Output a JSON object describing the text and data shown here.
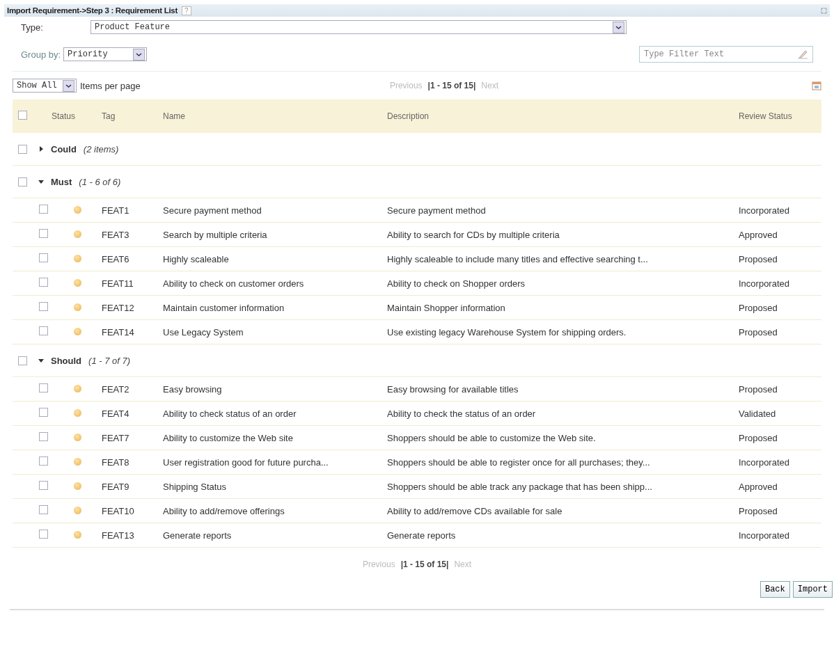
{
  "window": {
    "title": "Import Requirement->Step 3 : Requirement List",
    "help": "?"
  },
  "type_field": {
    "label": "Type:",
    "value": "Product Feature"
  },
  "group_by": {
    "label": "Group by:",
    "value": "Priority"
  },
  "filter": {
    "placeholder": "Type Filter Text"
  },
  "paging": {
    "page_size": "Show All",
    "page_size_label": "Items per page",
    "previous": "Previous",
    "range": "|1 - 15 of 15|",
    "next": "Next"
  },
  "table": {
    "select_all_checked": false,
    "columns": [
      "Status",
      "Tag",
      "Name",
      "Description",
      "Review Status"
    ],
    "groups": [
      {
        "name": "Could",
        "count": "(2 items)",
        "expanded": false,
        "checked": false
      },
      {
        "name": "Must",
        "count": "(1 - 6 of 6)",
        "expanded": true,
        "checked": false,
        "rows": [
          {
            "checked": false,
            "tag": "FEAT1",
            "name": "Secure payment method",
            "description": "Secure payment method",
            "review_status": "Incorporated"
          },
          {
            "checked": false,
            "tag": "FEAT3",
            "name": "Search by multiple criteria",
            "description": "Ability to search for CDs by multiple criteria",
            "review_status": "Approved"
          },
          {
            "checked": false,
            "tag": "FEAT6",
            "name": "Highly scaleable",
            "description": "Highly scaleable to include many titles and effective searching t...",
            "review_status": "Proposed"
          },
          {
            "checked": false,
            "tag": "FEAT11",
            "name": "Ability to check on customer orders",
            "description": "Ability to check on Shopper orders",
            "review_status": "Incorporated"
          },
          {
            "checked": false,
            "tag": "FEAT12",
            "name": "Maintain customer information",
            "description": "Maintain Shopper information",
            "review_status": "Proposed"
          },
          {
            "checked": false,
            "tag": "FEAT14",
            "name": "Use Legacy System",
            "description": "Use existing legacy Warehouse System for shipping orders.",
            "review_status": "Proposed"
          }
        ]
      },
      {
        "name": "Should",
        "count": "(1 - 7 of 7)",
        "expanded": true,
        "checked": false,
        "rows": [
          {
            "checked": false,
            "tag": "FEAT2",
            "name": "Easy browsing",
            "description": "Easy browsing for available titles",
            "review_status": "Proposed"
          },
          {
            "checked": false,
            "tag": "FEAT4",
            "name": "Ability to check status of an order",
            "description": "Ability to check the status of an order",
            "review_status": "Validated"
          },
          {
            "checked": false,
            "tag": "FEAT7",
            "name": "Ability to customize the Web site",
            "description": "Shoppers should be able to customize the Web site.",
            "review_status": "Proposed"
          },
          {
            "checked": false,
            "tag": "FEAT8",
            "name": "User registration good for future purcha...",
            "description": "Shoppers should be able to register once for all purchases; they...",
            "review_status": "Incorporated"
          },
          {
            "checked": false,
            "tag": "FEAT9",
            "name": "Shipping Status",
            "description": "Shoppers should be able track any package that has been shipp...",
            "review_status": "Approved"
          },
          {
            "checked": false,
            "tag": "FEAT10",
            "name": "Ability to add/remove offerings",
            "description": "Ability to add/remove CDs available for sale",
            "review_status": "Proposed"
          },
          {
            "checked": false,
            "tag": "FEAT13",
            "name": "Generate reports",
            "description": "Generate reports",
            "review_status": "Incorporated"
          }
        ]
      }
    ]
  },
  "bottom_paging": {
    "previous": "Previous",
    "range": "|1 - 15 of 15|",
    "next": "Next"
  },
  "buttons": [
    "Back",
    "Import"
  ]
}
